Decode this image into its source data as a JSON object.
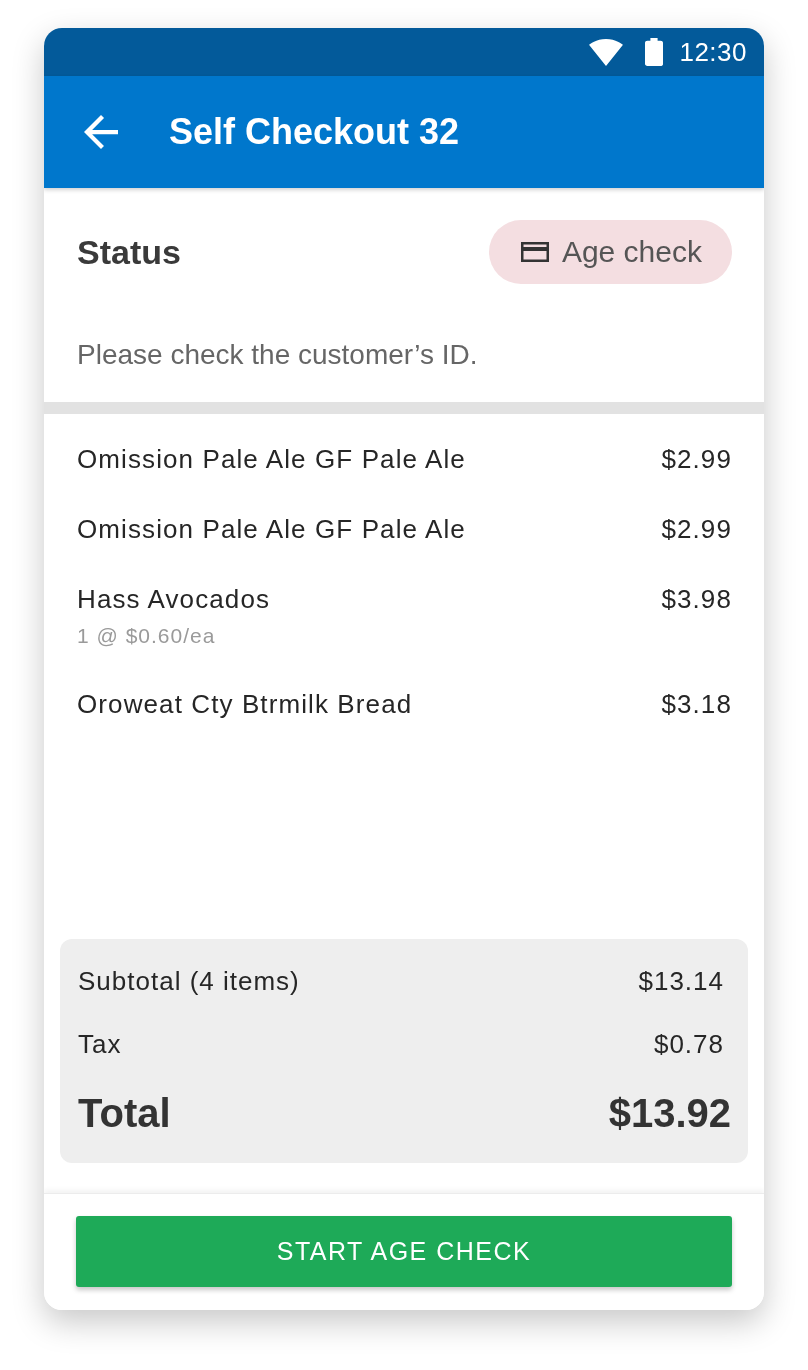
{
  "status_bar": {
    "time": "12:30"
  },
  "app_bar": {
    "title": "Self Checkout 32"
  },
  "status": {
    "heading": "Status",
    "badge": {
      "label": "Age check"
    },
    "message": "Please check the customer’s ID."
  },
  "items": [
    {
      "name": "Omission Pale Ale GF Pale Ale",
      "price": "$2.99"
    },
    {
      "name": "Omission Pale Ale GF Pale Ale",
      "price": "$2.99"
    },
    {
      "name": "Hass Avocados",
      "price": "$3.98",
      "detail": "1 @ $0.60/ea"
    },
    {
      "name": "Oroweat Cty Btrmilk Bread",
      "price": "$3.18"
    }
  ],
  "totals": [
    {
      "kind": "line",
      "label": "Subtotal (4 items)",
      "amount": "$13.14"
    },
    {
      "kind": "line",
      "label": "Tax",
      "amount": "$0.78"
    },
    {
      "kind": "total",
      "label": "Total",
      "amount": "$13.92"
    }
  ],
  "action": {
    "label": "START AGE CHECK"
  }
}
